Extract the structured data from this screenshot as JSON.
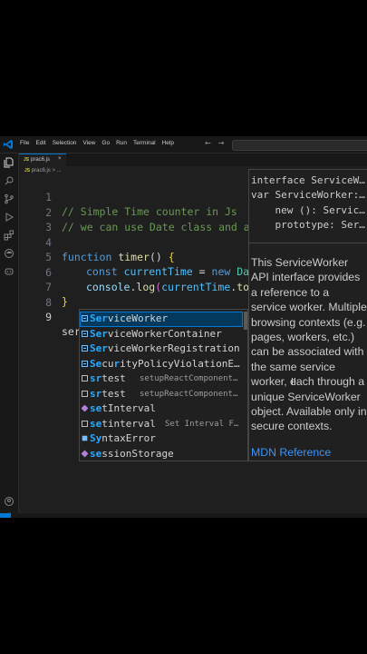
{
  "menu": [
    "File",
    "Edit",
    "Selection",
    "View",
    "Go",
    "Run",
    "Terminal",
    "Help"
  ],
  "nav": {
    "back": "←",
    "forward": "→"
  },
  "tab": {
    "icon": "JS",
    "filename": "prac6.js",
    "close": "×"
  },
  "breadcrumb": {
    "icon": "JS",
    "file": "prac6.js",
    "sep": ">",
    "rest": "..."
  },
  "code": {
    "line1": {
      "num": "1",
      "text": "// Simple Time counter in Js"
    },
    "line2": {
      "num": "2",
      "text": "// we can use Date class and al"
    },
    "line3": {
      "num": "3"
    },
    "line4": {
      "num": "4",
      "kw": "function",
      "fn": "timer",
      "rest": "()",
      "brace": "{"
    },
    "line5": {
      "num": "5",
      "kw": "const",
      "var": "currentTime",
      "eq": " = ",
      "kw2": "new",
      "cls": "Dat"
    },
    "line6": {
      "num": "6",
      "obj": "console",
      "dot": ".",
      "fn": "log",
      "paren": "(",
      "var": "currentTime",
      "dot2": ".",
      "fn2": "toL"
    },
    "line7": {
      "num": "7",
      "brace": "}"
    },
    "line8": {
      "num": "8"
    },
    "line9": {
      "num": "9",
      "text": "ser"
    }
  },
  "suggestions": [
    {
      "kind": "iface",
      "match": "Ser",
      "rest": "viceWorker",
      "detail": "",
      "selected": true
    },
    {
      "kind": "iface",
      "match": "Ser",
      "rest": "viceWorkerContainer",
      "detail": ""
    },
    {
      "kind": "iface",
      "match": "Ser",
      "rest": "viceWorkerRegistration",
      "detail": ""
    },
    {
      "kind": "iface",
      "pre": "S",
      "match": "e",
      "mid": "cu",
      "match2": "r",
      "rest": "ityPolicyViolationE…",
      "detail": ""
    },
    {
      "kind": "snip",
      "pre": "",
      "match": "sr",
      "rest": "test",
      "detail": "setupReactComponent…"
    },
    {
      "kind": "snip",
      "pre": "",
      "match": "sr",
      "rest": "test",
      "detail": "setupReactComponent…"
    },
    {
      "kind": "fun",
      "pre": "",
      "match": "se",
      "rest": "tInterval",
      "detail": ""
    },
    {
      "kind": "snip",
      "pre": "",
      "match": "se",
      "rest": "tinterval",
      "detail": "Set Interval F…"
    },
    {
      "kind": "vari",
      "pre": "Sy",
      "match": "",
      "rest": "ntaxError",
      "detail": ""
    },
    {
      "kind": "func2",
      "pre": "",
      "match": "se",
      "rest": "ssionStorage",
      "detail": ""
    }
  ],
  "suggestion_text": [
    "ServiceWorker",
    "ServiceWorkerContainer",
    "ServiceWorkerRegistration",
    "SecurityPolicyViolationE…",
    "srtest",
    "srtest",
    "setInterval",
    "setinterval",
    "SyntaxError",
    "sessionStorage"
  ],
  "doc": {
    "sig1": "interface ServiceW…",
    "sig2": "var ServiceWorker:…",
    "sig3": "    new (): Servic…",
    "sig4": "    prototype: Ser…",
    "description": "This ServiceWorker API interface provides a reference to a service worker. Multiple browsing contexts (e.g. pages, workers, etc.) can be associated with the same service worker, each through a unique ServiceWorker object. Available only in secure contexts.",
    "link": "MDN Reference"
  },
  "colors": {
    "accent": "#0078d4",
    "comment": "#6a9955",
    "keyword": "#569cd6",
    "function": "#dcdcaa",
    "match": "#2aaaff"
  }
}
